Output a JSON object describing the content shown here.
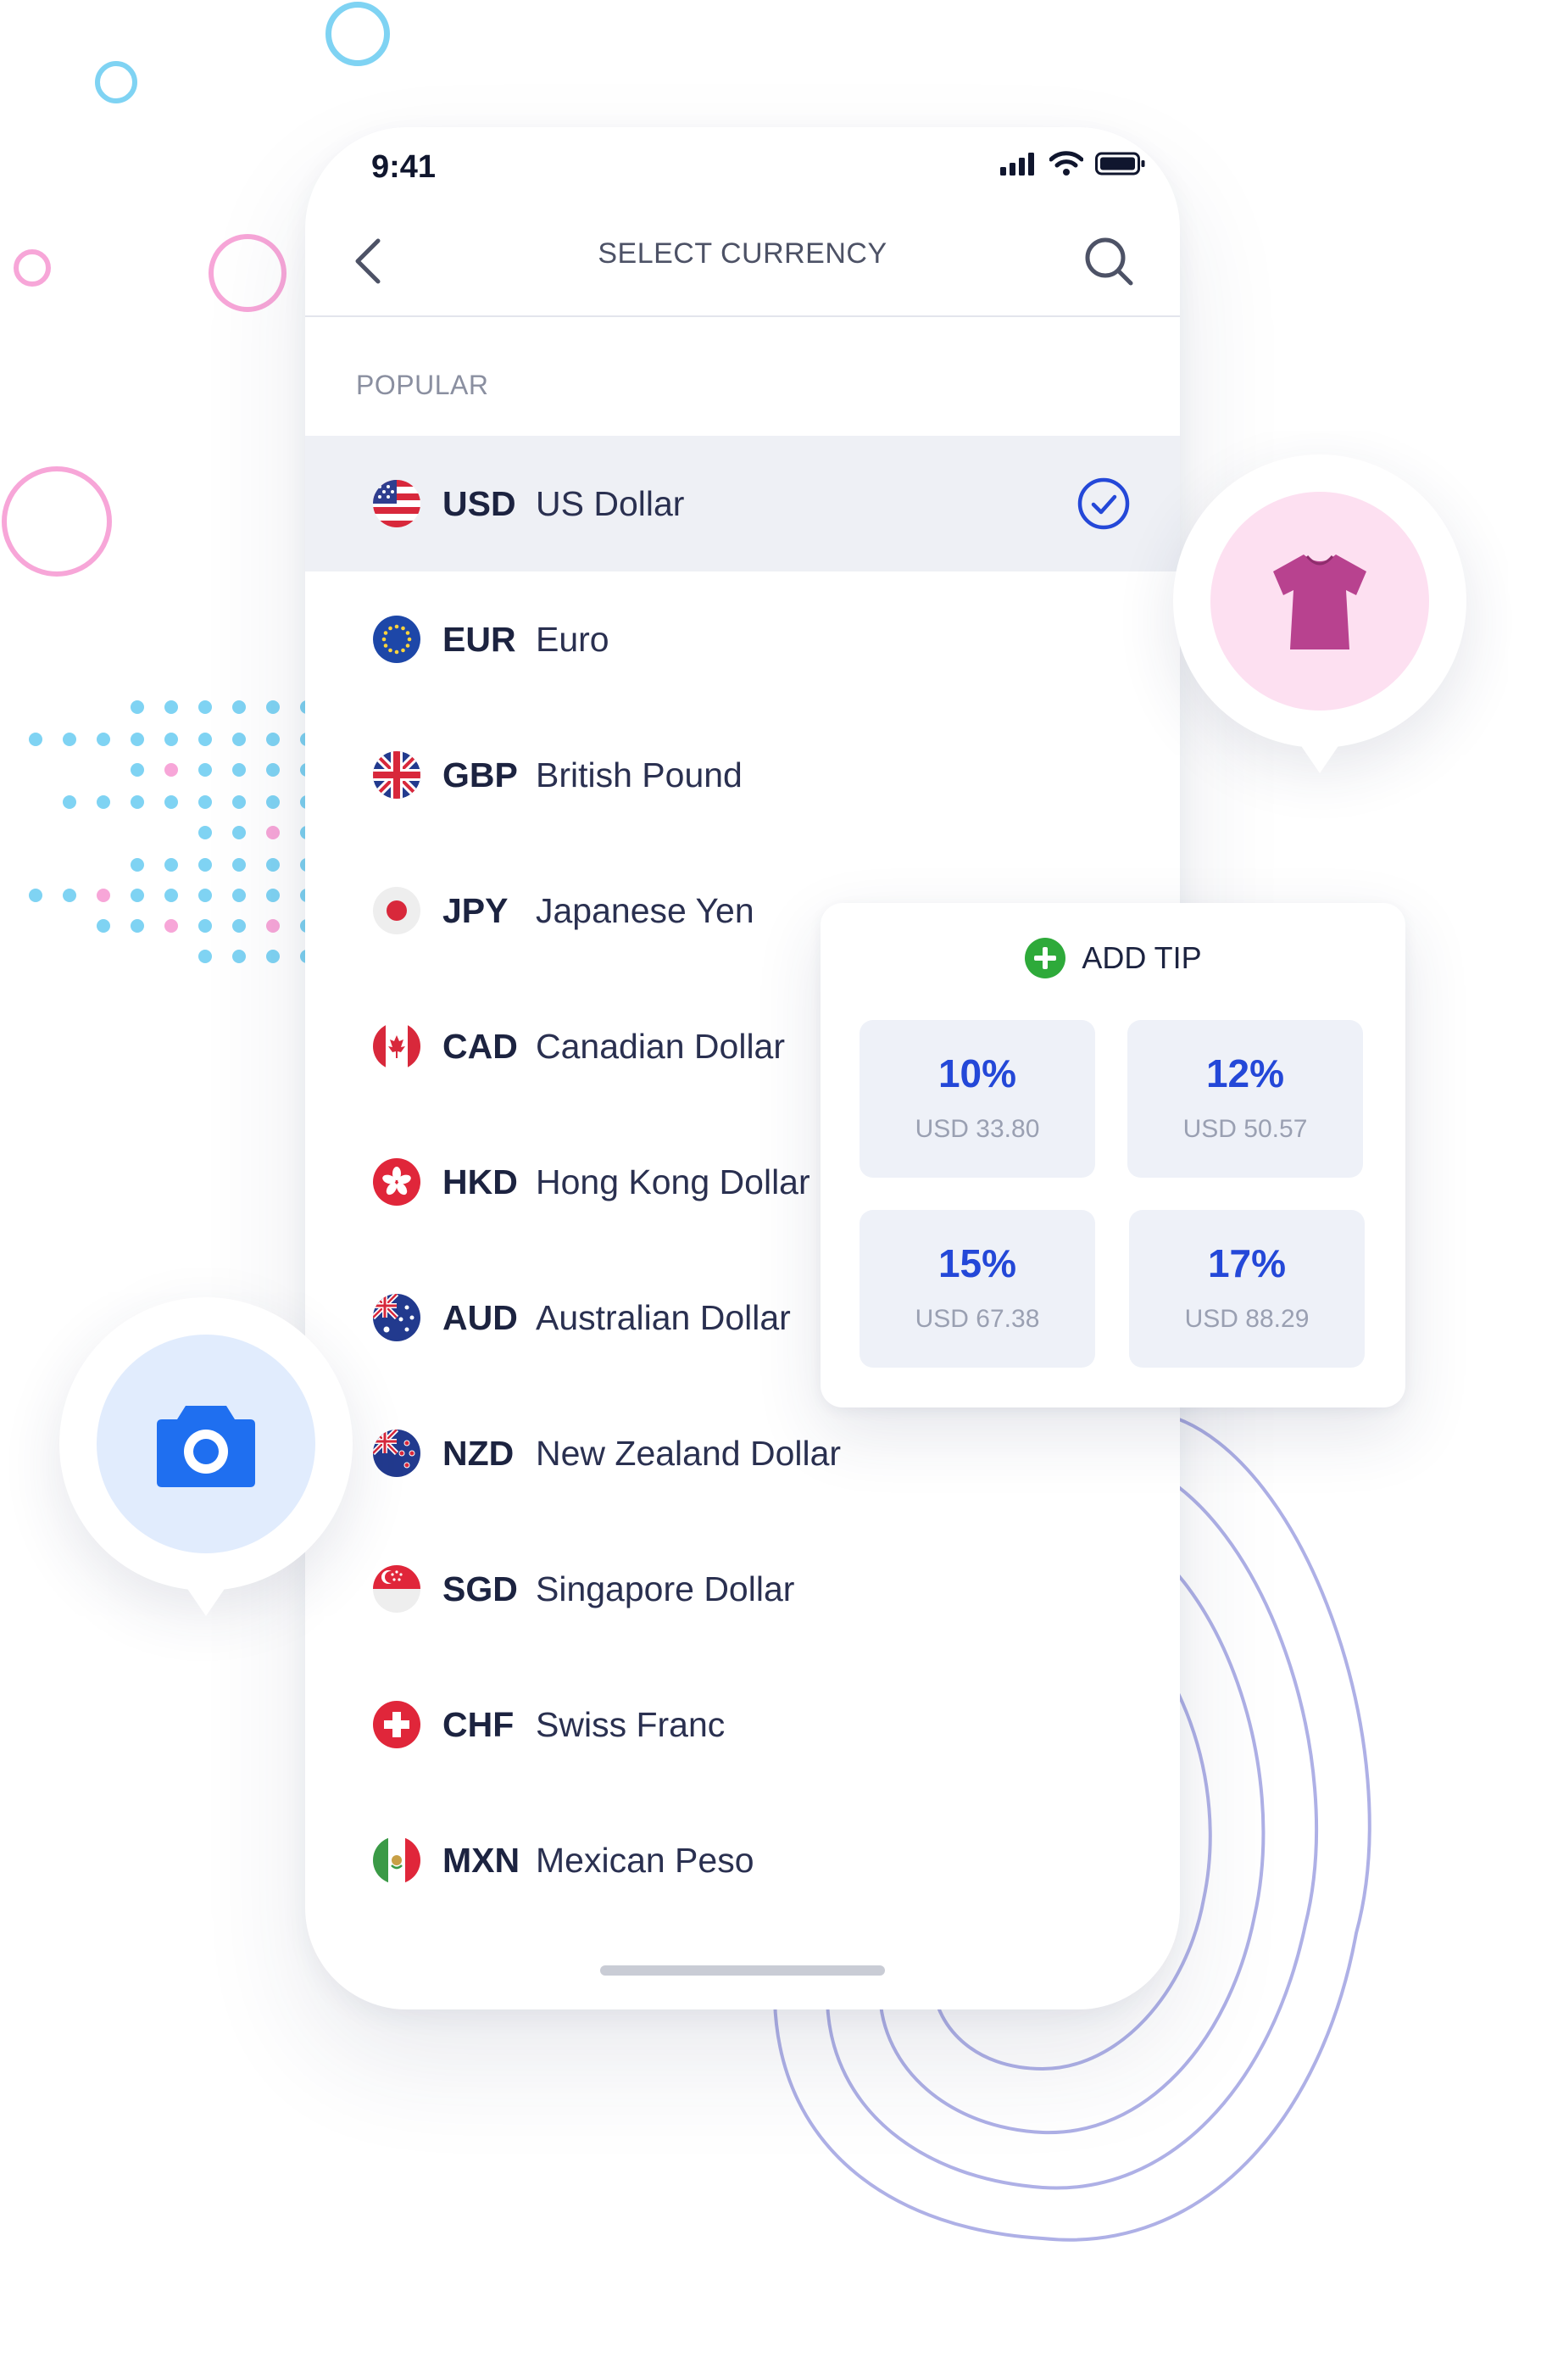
{
  "status_bar": {
    "time": "9:41"
  },
  "header": {
    "title": "SELECT CURRENCY"
  },
  "section": {
    "label": "POPULAR"
  },
  "currencies": [
    {
      "code": "USD",
      "name": "US Dollar",
      "selected": true
    },
    {
      "code": "EUR",
      "name": "Euro"
    },
    {
      "code": "GBP",
      "name": "British Pound"
    },
    {
      "code": "JPY",
      "name": "Japanese Yen"
    },
    {
      "code": "CAD",
      "name": "Canadian Dollar"
    },
    {
      "code": "HKD",
      "name": "Hong Kong Dollar"
    },
    {
      "code": "AUD",
      "name": "Australian Dollar"
    },
    {
      "code": "NZD",
      "name": "New Zealand Dollar"
    },
    {
      "code": "SGD",
      "name": "Singapore Dollar"
    },
    {
      "code": "CHF",
      "name": "Swiss Franc"
    },
    {
      "code": "MXN",
      "name": "Mexican Peso"
    }
  ],
  "tip": {
    "title": "ADD TIP",
    "options": [
      {
        "percent": "10%",
        "amount": "USD 33.80"
      },
      {
        "percent": "12%",
        "amount": "USD 50.57"
      },
      {
        "percent": "15%",
        "amount": "USD 67.38"
      },
      {
        "percent": "17%",
        "amount": "USD 88.29"
      }
    ]
  },
  "icons": {
    "shirt_pin": "shirt-icon",
    "camera_pin": "camera-icon",
    "selected_mark": "check-circle-icon",
    "add_tip": "plus-circle-icon"
  },
  "colors": {
    "accent": "#2448d8",
    "selected_row": "#eef0f5",
    "add_green": "#2eaa3a",
    "shirt": "#b8428f",
    "camera": "#1f6ff0"
  }
}
